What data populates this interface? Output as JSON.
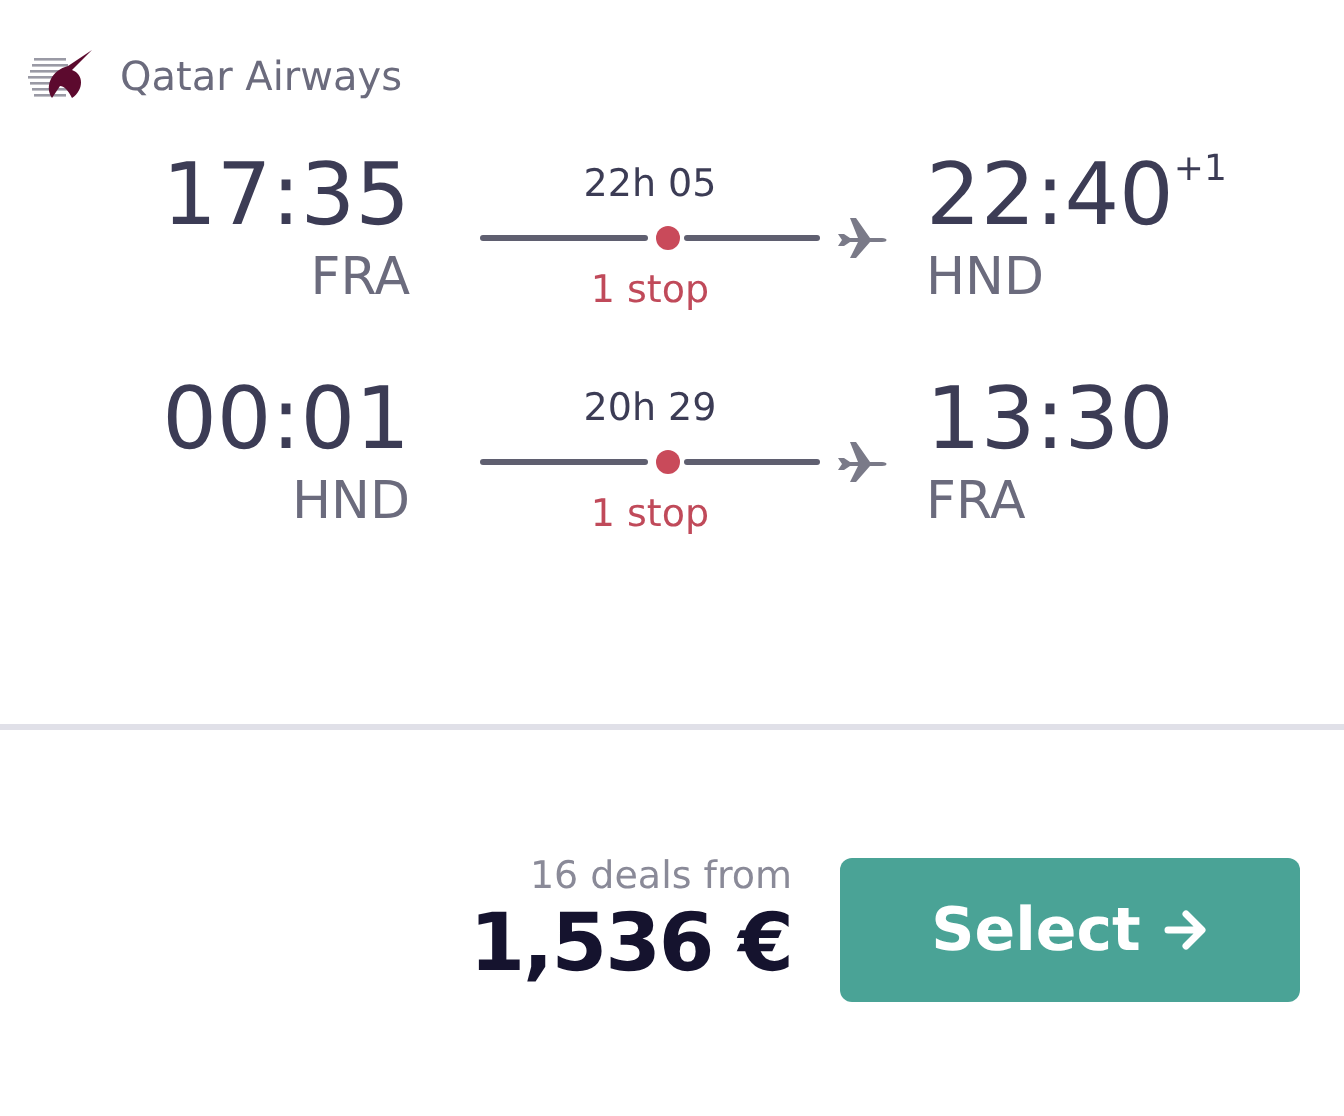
{
  "airline": {
    "name": "Qatar Airways"
  },
  "legs": [
    {
      "depart_time": "17:35",
      "depart_airport": "FRA",
      "duration": "22h 05",
      "stops": "1 stop",
      "arrive_time": "22:40",
      "day_offset": "+1",
      "arrive_airport": "HND"
    },
    {
      "depart_time": "00:01",
      "depart_airport": "HND",
      "duration": "20h 29",
      "stops": "1 stop",
      "arrive_time": "13:30",
      "arrive_airport": "FRA"
    }
  ],
  "footer": {
    "deals": "16 deals from",
    "price": "1,536 €",
    "button": "Select"
  }
}
